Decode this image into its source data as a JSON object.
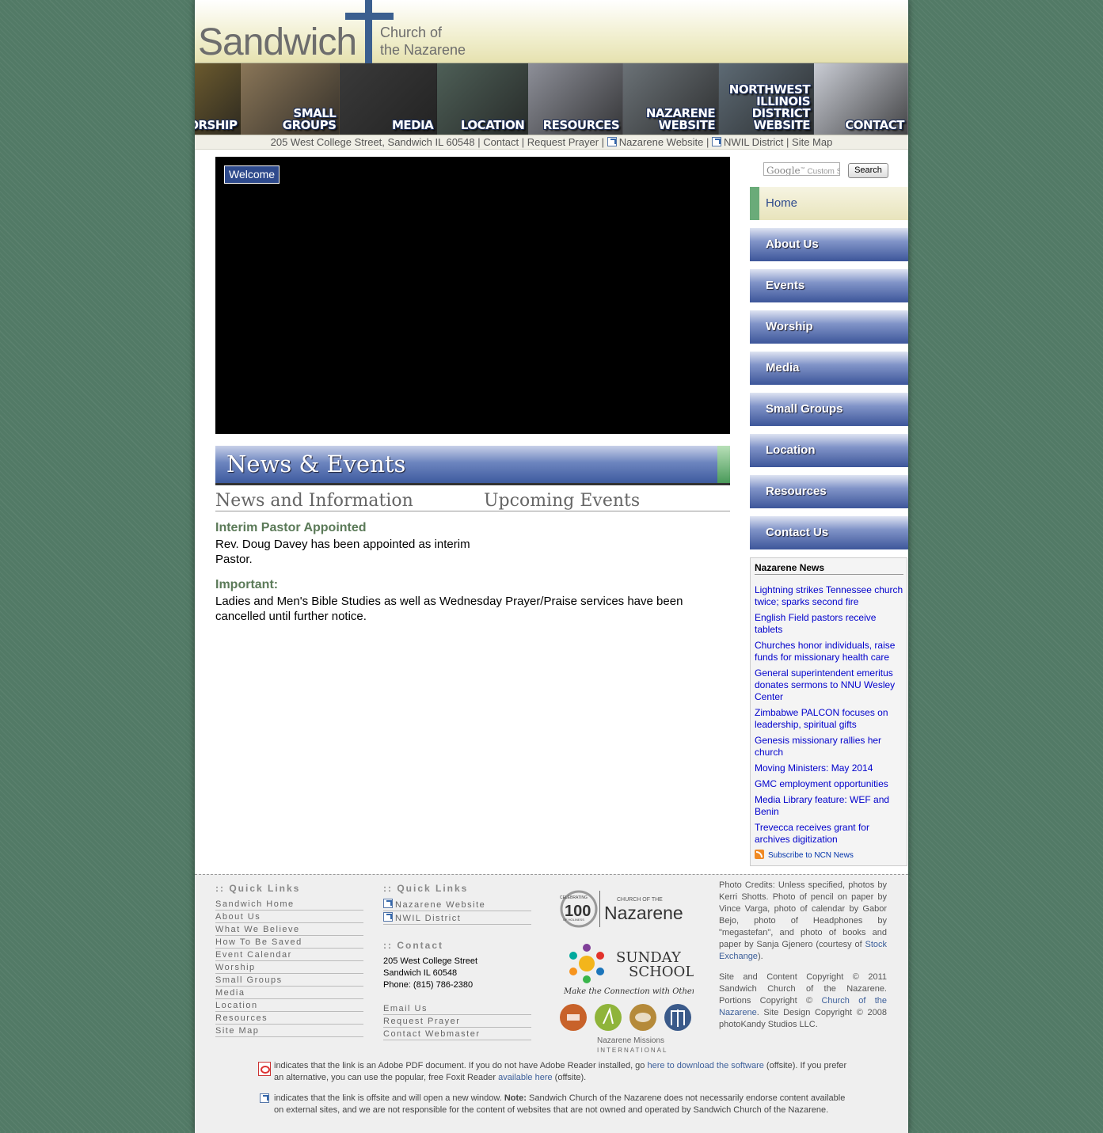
{
  "header": {
    "logo_word": "Sandwich",
    "logo_sub_line1": "Church of",
    "logo_sub_line2": "the Nazarene"
  },
  "banner": [
    {
      "label": "Worship",
      "display": "ORSHIP",
      "bg": "#6b5a2e"
    },
    {
      "label": "Small Groups",
      "display": "SMALL\nGROUPS",
      "bg": "#8a7658"
    },
    {
      "label": "Media",
      "display": "MEDIA",
      "bg": "#3a3a3a"
    },
    {
      "label": "Location",
      "display": "LOCATION",
      "bg": "#4e5f57"
    },
    {
      "label": "Resources",
      "display": "RESOURCES",
      "bg": "#8d8f98"
    },
    {
      "label": "Nazarene Website",
      "display": "NAZARENE\nWEBSITE",
      "bg": "#6b7277"
    },
    {
      "label": "Northwest Illinois District Website",
      "display": "NORTHWEST\nILLINOIS\nDISTRICT\nWEBSITE",
      "bg": "#5d6a74"
    },
    {
      "label": "Contact",
      "display": "CONTACT",
      "bg": "#c9ccd4"
    }
  ],
  "addressbar": {
    "address": "205 West College Street, Sandwich IL 60548",
    "sep": "|",
    "contact": "Contact",
    "request_prayer": "Request Prayer",
    "nazarene_website": "Nazarene Website",
    "nwil_district": "NWIL District",
    "site_map": "Site Map"
  },
  "video": {
    "tab_label": "Welcome"
  },
  "news": {
    "section_title": "News & Events",
    "col_left_title": "News and Information",
    "col_right_title": "Upcoming Events",
    "items": [
      {
        "head": "Interim Pastor Appointed",
        "body": "Rev. Doug Davey has been appointed as interim Pastor."
      },
      {
        "head": "Important:",
        "body": "Ladies and Men's Bible Studies as well as Wednesday Prayer/Praise services have been cancelled until further notice."
      }
    ]
  },
  "search": {
    "google_label": "Google",
    "placeholder": "Custom Se",
    "button": "Search"
  },
  "nav": [
    "Home",
    "About Us",
    "Events",
    "Worship",
    "Media",
    "Small Groups",
    "Location",
    "Resources",
    "Contact Us"
  ],
  "ncn": {
    "title": "Nazarene News",
    "links": [
      "Lightning strikes Tennessee church twice; sparks second fire",
      "English Field pastors receive tablets",
      "Churches honor individuals, raise funds for missionary health care",
      "General superintendent emeritus donates sermons to NNU Wesley Center",
      "Zimbabwe PALCON focuses on leadership, spiritual gifts",
      "Genesis missionary rallies her church",
      "Moving Ministers: May 2014",
      "GMC employment opportunities",
      "Media Library feature: WEF and Benin",
      "Trevecca receives grant for archives digitization"
    ],
    "subscribe": "Subscribe to NCN News"
  },
  "footer": {
    "quick_links_title": ":: Quick Links",
    "quick_links_1": [
      "Sandwich Home",
      "About Us",
      "What We Believe",
      "How To Be Saved",
      "Event Calendar",
      "Worship",
      "Small Groups",
      "Media",
      "Location",
      "Resources",
      "Site Map"
    ],
    "quick_links_2": [
      "Nazarene Website",
      "NWIL District"
    ],
    "contact_title": ":: Contact",
    "contact_street": "205 West College Street",
    "contact_city": "Sandwich IL 60548",
    "contact_phone": "Phone: (815) 786-2380",
    "contact_links": [
      "Email Us",
      "Request Prayer",
      "Contact Webmaster"
    ],
    "logos": {
      "celebrating": "CELEBRATING",
      "hundred": "100",
      "of_holiness": "OF HOLINESS",
      "church_of_the": "CHURCH OF THE",
      "nazarene": "Nazarene",
      "sunday": "SUNDAY",
      "school": "SCHOOL",
      "ss_tagline": "Make the Connection with Others",
      "nmi_line1": "Nazarene Missions",
      "nmi_line2": "INTERNATIONAL"
    },
    "credits_1a": "Photo Credits: Unless specified, photos by Kerri Shotts. Photo of pencil on paper by Vince Varga, photo of calendar by Gabor Bejo, photo of Headphones by \"megastefan\", and photo of books and paper by Sanja Gjenero (courtesy of ",
    "credits_1_link": "Stock Exchange",
    "credits_1b": ").",
    "credits_2a": "Site and Content Copyright © 2011 Sandwich Church of the Nazarene. Portions Copyright © ",
    "credits_2_link": "Church of the Nazarene",
    "credits_2b": ". Site Design Copyright © 2008 photoKandy Studios LLC.",
    "pdf_notice_a": "indicates that the link is an Adobe PDF document. If you do not have Adobe Reader installed, go ",
    "pdf_notice_link1": "here to download the software",
    "pdf_notice_b": " (offsite). If you prefer an alternative, you can use the popular, free Foxit Reader ",
    "pdf_notice_link2": "available here",
    "pdf_notice_c": " (offsite).",
    "ext_notice_a": "indicates that the link is offsite and will open a new window. ",
    "ext_notice_note": "Note:",
    "ext_notice_b": " Sandwich Church of the Nazarene does not necessarily endorse content available on external sites, and we are not responsible for the content of websites that are not owned and operated by Sandwich Church of the Nazarene."
  },
  "colors": {
    "nav_blue": "#3d569a",
    "heading_green": "#5b7a58",
    "link_blue": "#0000cc",
    "bg_green": "#527a66"
  }
}
